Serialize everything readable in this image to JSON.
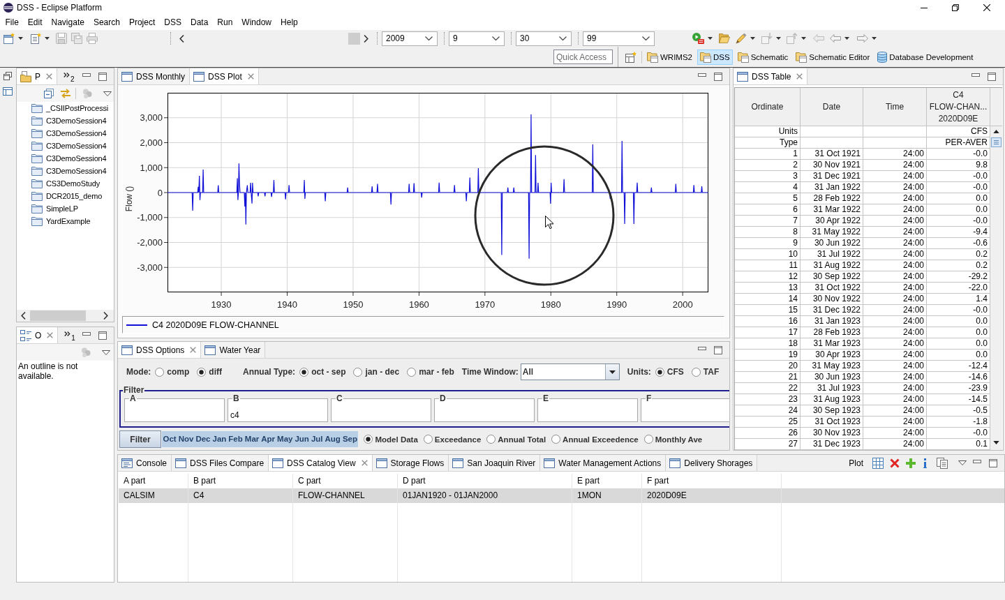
{
  "window": {
    "title": "DSS - Eclipse Platform"
  },
  "menu": [
    "File",
    "Edit",
    "Navigate",
    "Search",
    "Project",
    "DSS",
    "Data",
    "Run",
    "Window",
    "Help"
  ],
  "toolbar": {
    "combos": [
      "2009",
      "9",
      "30",
      "99"
    ]
  },
  "quick_access": {
    "placeholder": "Quick Access"
  },
  "perspectives": [
    {
      "label": "WRIMS2",
      "selected": false,
      "kind": "folder"
    },
    {
      "label": "DSS",
      "selected": true,
      "kind": "folder"
    },
    {
      "label": "Schematic",
      "selected": false,
      "kind": "folder"
    },
    {
      "label": "Schematic Editor",
      "selected": false,
      "kind": "folder"
    },
    {
      "label": "Database Development",
      "selected": false,
      "kind": "database"
    }
  ],
  "project_explorer": {
    "tab": {
      "label": "P",
      "selected": true
    },
    "hidden_count": "2",
    "items": [
      "_CSIIPostProcessi",
      "C3DemoSession4",
      "C3DemoSession4",
      "C3DemoSession4",
      "C3DemoSession4",
      "C3DemoSession4",
      "CS3DemoStudy",
      "DCR2015_demo",
      "SimpleLP",
      "YardExample"
    ]
  },
  "outline": {
    "tab": {
      "label": "O",
      "selected": true
    },
    "hidden_count": "1",
    "message": "An outline is not available."
  },
  "plot_panel": {
    "tabs": [
      {
        "label": "DSS Monthly",
        "selected": false
      },
      {
        "label": "DSS Plot",
        "selected": true
      }
    ],
    "chart_data": {
      "type": "line",
      "ylabel": "Flow ()",
      "grid": true,
      "x": [
        1921.84,
        1925.58,
        1925.66,
        1925.74,
        1926.42,
        1926.5,
        1926.58,
        1926.68,
        1926.76,
        1926.84,
        1927.17,
        1927.25,
        1927.33,
        1929.46,
        1929.54,
        1929.62,
        1932.36,
        1932.44,
        1932.52,
        1932.6,
        1932.68,
        1932.76,
        1932.84,
        1933.49,
        1933.57,
        1933.65,
        1933.73,
        1933.81,
        1933.95,
        1934.03,
        1934.37,
        1934.45,
        1934.53,
        1934.66,
        1934.74,
        1934.82,
        1935.52,
        1935.6,
        1935.68,
        1936.55,
        1936.63,
        1936.71,
        1937.55,
        1937.63,
        1937.71,
        1937.9,
        1937.98,
        1938.06,
        1939.67,
        1939.75,
        1939.83,
        1940.2,
        1940.28,
        1940.36,
        1942.52,
        1942.6,
        1942.68,
        1942.76,
        1945.7,
        1945.78,
        1945.86,
        1949.09,
        1949.17,
        1949.25,
        1952.8,
        1952.88,
        1952.96,
        1953.62,
        1953.7,
        1953.78,
        1955.66,
        1955.74,
        1955.82,
        1958.42,
        1958.5,
        1958.58,
        1959.16,
        1959.24,
        1959.32,
        1960.32,
        1960.4,
        1960.48,
        1962.97,
        1963.05,
        1963.13,
        1965.3,
        1965.38,
        1965.46,
        1967.1,
        1967.18,
        1967.26,
        1967.63,
        1967.71,
        1967.79,
        1968.92,
        1969.0,
        1969.08,
        1972.47,
        1972.55,
        1972.63,
        1973.4,
        1973.48,
        1973.56,
        1974.3,
        1974.38,
        1974.46,
        1976.62,
        1976.7,
        1976.78,
        1976.92,
        1977.0,
        1977.08,
        1977.6,
        1977.68,
        1977.76,
        1977.98,
        1978.06,
        1978.14,
        1979.88,
        1979.96,
        1980.04,
        1980.12,
        1981.92,
        1982.0,
        1982.08,
        1986.28,
        1986.36,
        1986.44,
        1988.92,
        1989.0,
        1989.08,
        1990.72,
        1990.8,
        1990.88,
        1991.12,
        1991.2,
        1991.28,
        1992.52,
        1992.6,
        1992.68,
        1993.02,
        1993.1,
        1993.18,
        1995.17,
        1995.25,
        1995.33,
        1998.88,
        1998.96,
        1999.04,
        2001.62,
        2001.7,
        2001.78,
        2002.82,
        2002.9,
        2002.98,
        2003.9
      ],
      "series": [
        {
          "name": "C4 2020D09E FLOW-CHANNEL",
          "color": "#1010d8",
          "values": [
            0,
            0,
            -730,
            0,
            0,
            230,
            0,
            670,
            -300,
            0,
            0,
            920,
            0,
            0,
            290,
            0,
            0,
            570,
            -300,
            0,
            1170,
            390,
            0,
            0,
            -560,
            0,
            -1280,
            0,
            290,
            0,
            0,
            390,
            0,
            -440,
            390,
            0,
            0,
            -150,
            0,
            0,
            -150,
            0,
            0,
            -170,
            0,
            0,
            500,
            0,
            0,
            -270,
            0,
            0,
            300,
            0,
            0,
            500,
            -250,
            0,
            0,
            -350,
            0,
            0,
            200,
            0,
            0,
            250,
            0,
            0,
            350,
            0,
            0,
            -480,
            0,
            0,
            350,
            0,
            0,
            380,
            0,
            0,
            -200,
            0,
            0,
            400,
            0,
            0,
            300,
            0,
            0,
            -350,
            0,
            0,
            600,
            0,
            0,
            980,
            0,
            0,
            -2500,
            0,
            0,
            200,
            0,
            0,
            200,
            0,
            0,
            -2650,
            0,
            0,
            3130,
            0,
            0,
            1500,
            0,
            0,
            390,
            0,
            0,
            -450,
            390,
            0,
            0,
            540,
            0,
            0,
            1930,
            0,
            0,
            -250,
            0,
            0,
            2070,
            0,
            0,
            -1260,
            0,
            0,
            -1260,
            0,
            0,
            400,
            0,
            0,
            200,
            0,
            0,
            350,
            0,
            0,
            300,
            0,
            0,
            250,
            0,
            0
          ]
        }
      ],
      "xlim": [
        1921.84,
        2003.9
      ],
      "ylim": [
        -4000,
        4000
      ],
      "xticks": [
        1930,
        1940,
        1950,
        1960,
        1970,
        1980,
        1990,
        2000
      ],
      "yticks": [
        {
          "value": -3000,
          "label": "-3,000"
        },
        {
          "value": -2000,
          "label": "-2,000"
        },
        {
          "value": -1000,
          "label": "-1,000"
        },
        0,
        {
          "value": 1000,
          "label": "1,000"
        },
        {
          "value": 2000,
          "label": "2,000"
        },
        {
          "value": 3000,
          "label": "3,000"
        }
      ]
    }
  },
  "options_panel": {
    "tabs": [
      {
        "label": "DSS Options",
        "selected": true
      },
      {
        "label": "Water Year",
        "selected": false
      }
    ],
    "row_items": [
      {
        "kind": "radios",
        "label": "Mode:",
        "options": [
          {
            "label": "comp",
            "selected": false
          },
          {
            "label": "diff",
            "selected": true
          }
        ]
      },
      {
        "kind": "radios",
        "label": "Annual Type:",
        "options": [
          {
            "label": "oct - sep",
            "selected": true
          },
          {
            "label": "jan - dec",
            "selected": false
          },
          {
            "label": "mar - feb",
            "selected": false
          }
        ]
      },
      {
        "kind": "combo",
        "label": "Time Window:",
        "value": "All"
      },
      {
        "kind": "radios",
        "label": "Units:",
        "options": [
          {
            "label": "CFS",
            "selected": true
          },
          {
            "label": "TAF",
            "selected": false
          }
        ]
      }
    ],
    "filter": {
      "title": "Filter",
      "fields": [
        {
          "label": "A"
        },
        {
          "label": "B",
          "value": "c4"
        },
        {
          "label": "C"
        },
        {
          "label": "D"
        },
        {
          "label": "E"
        },
        {
          "label": "F"
        }
      ]
    },
    "filter_button": "Filter",
    "months": [
      {
        "label": "Oct",
        "selected": true
      },
      {
        "label": "Nov",
        "selected": true
      },
      {
        "label": "Dec",
        "selected": true
      },
      {
        "label": "Jan",
        "selected": true
      },
      {
        "label": "Feb",
        "selected": true
      },
      {
        "label": "Mar",
        "selected": true
      },
      {
        "label": "Apr",
        "selected": true
      },
      {
        "label": "May",
        "selected": true
      },
      {
        "label": "Jun",
        "selected": true
      },
      {
        "label": "Jul",
        "selected": true
      },
      {
        "label": "Aug",
        "selected": true
      },
      {
        "label": "Sep",
        "selected": true
      }
    ],
    "views": [
      {
        "label": "Model Data",
        "selected": true
      },
      {
        "label": "Exceedance",
        "selected": false
      },
      {
        "label": "Annual Total",
        "selected": false
      },
      {
        "label": "Annual Exceedence",
        "selected": false
      },
      {
        "label": "Monthly Ave",
        "selected": false
      }
    ]
  },
  "table_panel": {
    "tab": {
      "label": "DSS Table",
      "selected": true
    },
    "columns": [
      {
        "lines": [
          "Ordinate"
        ]
      },
      {
        "lines": [
          "Date"
        ]
      },
      {
        "lines": [
          "Time"
        ]
      },
      {
        "lines": [
          "C4",
          "FLOW-CHAN...",
          "2020D09E"
        ]
      }
    ],
    "meta_rows": [
      {
        "label": "Units",
        "value": "CFS"
      },
      {
        "label": "Type",
        "value": "PER-AVER"
      }
    ],
    "rows": [
      [
        "1",
        "31 Oct 1921",
        "24:00",
        "-0.0"
      ],
      [
        "2",
        "30 Nov 1921",
        "24:00",
        "9.8"
      ],
      [
        "3",
        "31 Dec 1921",
        "24:00",
        "-0.0"
      ],
      [
        "4",
        "31 Jan 1922",
        "24:00",
        "-0.0"
      ],
      [
        "5",
        "28 Feb 1922",
        "24:00",
        "0.0"
      ],
      [
        "6",
        "31 Mar 1922",
        "24:00",
        "0.0"
      ],
      [
        "7",
        "30 Apr 1922",
        "24:00",
        "-0.0"
      ],
      [
        "8",
        "31 May 1922",
        "24:00",
        "-9.4"
      ],
      [
        "9",
        "30 Jun 1922",
        "24:00",
        "-0.6"
      ],
      [
        "10",
        "31 Jul 1922",
        "24:00",
        "0.2"
      ],
      [
        "11",
        "31 Aug 1922",
        "24:00",
        "0.2"
      ],
      [
        "12",
        "30 Sep 1922",
        "24:00",
        "-29.2"
      ],
      [
        "13",
        "31 Oct 1922",
        "24:00",
        "-22.0"
      ],
      [
        "14",
        "30 Nov 1922",
        "24:00",
        "1.4"
      ],
      [
        "15",
        "31 Dec 1922",
        "24:00",
        "-0.0"
      ],
      [
        "16",
        "31 Jan 1923",
        "24:00",
        "0.0"
      ],
      [
        "17",
        "28 Feb 1923",
        "24:00",
        "0.0"
      ],
      [
        "18",
        "31 Mar 1923",
        "24:00",
        "0.0"
      ],
      [
        "19",
        "30 Apr 1923",
        "24:00",
        "0.0"
      ],
      [
        "20",
        "31 May 1923",
        "24:00",
        "-12.4"
      ],
      [
        "21",
        "30 Jun 1923",
        "24:00",
        "-14.6"
      ],
      [
        "22",
        "31 Jul 1923",
        "24:00",
        "-23.9"
      ],
      [
        "23",
        "31 Aug 1923",
        "24:00",
        "-14.5"
      ],
      [
        "24",
        "30 Sep 1923",
        "24:00",
        "-0.5"
      ],
      [
        "25",
        "31 Oct 1923",
        "24:00",
        "-1.8"
      ],
      [
        "26",
        "30 Nov 1923",
        "24:00",
        "-0.0"
      ],
      [
        "27",
        "31 Dec 1923",
        "24:00",
        "0.1"
      ]
    ]
  },
  "catalog_panel": {
    "tabs": [
      {
        "label": "Console",
        "selected": false,
        "kind": "console"
      },
      {
        "label": "DSS Files Compare",
        "selected": false,
        "kind": "view"
      },
      {
        "label": "DSS Catalog View",
        "selected": true,
        "kind": "view"
      },
      {
        "label": "Storage Flows",
        "selected": false,
        "kind": "view"
      },
      {
        "label": "San Joaquin River",
        "selected": false,
        "kind": "view"
      },
      {
        "label": "Water Management Actions",
        "selected": false,
        "kind": "view"
      },
      {
        "label": "Delivery Shorages",
        "selected": false,
        "kind": "view"
      }
    ],
    "toolbar_label": "Plot",
    "columns": [
      "A part",
      "B part",
      "C part",
      "D part",
      "E part",
      "F part"
    ],
    "rows": [
      {
        "selected": true,
        "cells": [
          "CALSIM",
          "C4",
          "FLOW-CHANNEL",
          "01JAN1920 - 01JAN2000",
          "1MON",
          "2020D09E"
        ]
      }
    ]
  }
}
